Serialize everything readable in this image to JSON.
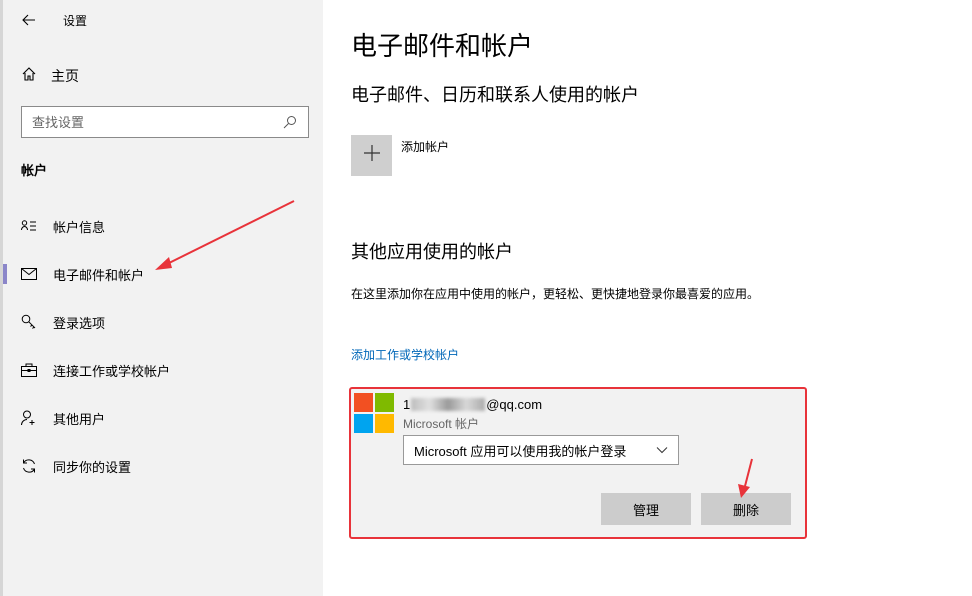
{
  "window": {
    "title": "设置"
  },
  "sidebar": {
    "home_label": "主页",
    "search_placeholder": "查找设置",
    "section_title": "帐户",
    "items": [
      {
        "label": "帐户信息",
        "icon": "account-info-icon"
      },
      {
        "label": "电子邮件和帐户",
        "icon": "mail-icon",
        "active": true
      },
      {
        "label": "登录选项",
        "icon": "key-icon"
      },
      {
        "label": "连接工作或学校帐户",
        "icon": "briefcase-icon"
      },
      {
        "label": "其他用户",
        "icon": "add-person-icon"
      },
      {
        "label": "同步你的设置",
        "icon": "sync-icon"
      }
    ]
  },
  "main": {
    "title": "电子邮件和帐户",
    "email_section": {
      "heading": "电子邮件、日历和联系人使用的帐户",
      "add_account_label": "添加帐户"
    },
    "other_section": {
      "heading": "其他应用使用的帐户",
      "description": "在这里添加你在应用中使用的帐户，更轻松、更快捷地登录你最喜爱的应用。",
      "link_label": "添加工作或学校帐户"
    },
    "account": {
      "email_prefix": "1",
      "email_suffix": "@qq.com",
      "type": "Microsoft 帐户",
      "dropdown_value": "Microsoft 应用可以使用我的帐户登录",
      "manage_label": "管理",
      "delete_label": "删除"
    }
  },
  "colors": {
    "sidebar_bg": "#f2f2f2",
    "link": "#0067b8",
    "highlight_border": "#e8333a",
    "active_indicator": "#8b86c9",
    "ms_red": "#f25022",
    "ms_green": "#7fba00",
    "ms_blue": "#00a4ef",
    "ms_yellow": "#ffb900"
  }
}
